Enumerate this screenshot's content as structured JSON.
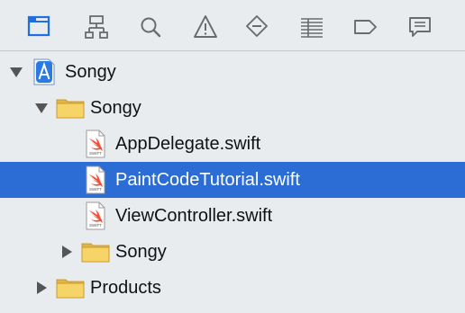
{
  "toolbar": {
    "active_color": "#1f6fe0",
    "icon_color": "#6b6b6b",
    "buttons": [
      {
        "name": "project-navigator-icon"
      },
      {
        "name": "source-control-navigator-icon"
      },
      {
        "name": "find-navigator-icon"
      },
      {
        "name": "issue-navigator-icon"
      },
      {
        "name": "test-navigator-icon"
      },
      {
        "name": "debug-navigator-icon"
      },
      {
        "name": "breakpoint-navigator-icon"
      },
      {
        "name": "report-navigator-icon"
      }
    ]
  },
  "tree": {
    "selection_color": "#2c6dd5",
    "items": [
      {
        "label": "Songy",
        "kind": "project",
        "expanded": true
      },
      {
        "label": "Songy",
        "kind": "folder",
        "expanded": true
      },
      {
        "label": "AppDelegate.swift",
        "kind": "swift-file",
        "file_badge": "SWIFT"
      },
      {
        "label": "PaintCodeTutorial.swift",
        "kind": "swift-file",
        "file_badge": "SWIFT",
        "selected": true
      },
      {
        "label": "ViewController.swift",
        "kind": "swift-file",
        "file_badge": "SWIFT"
      },
      {
        "label": "Songy",
        "kind": "folder",
        "expanded": false
      },
      {
        "label": "Products",
        "kind": "folder",
        "expanded": false
      }
    ]
  }
}
